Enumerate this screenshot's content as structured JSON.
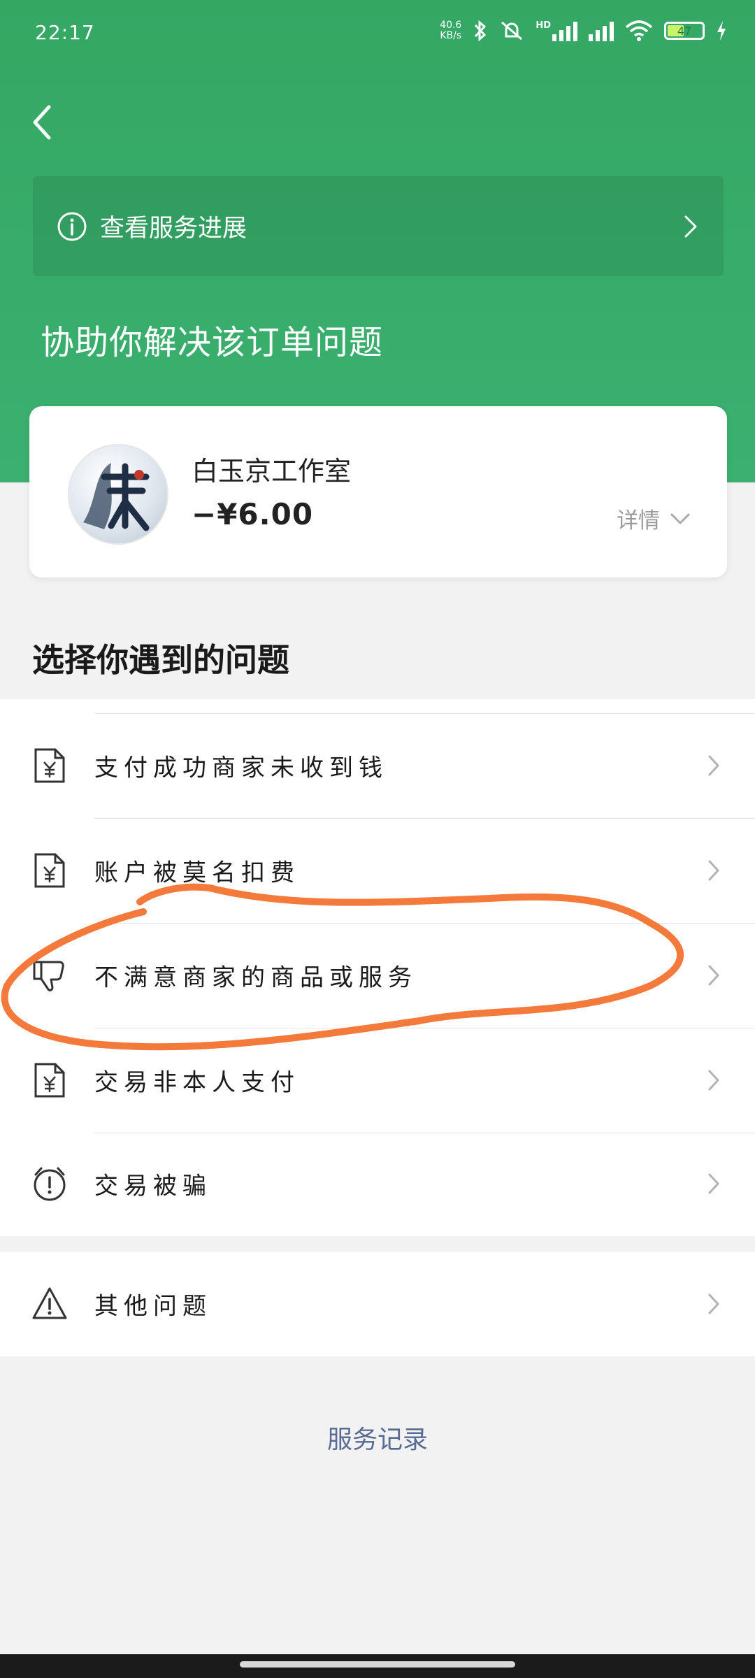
{
  "status_bar": {
    "time": "22:17",
    "net_speed_value": "40.6",
    "net_speed_unit": "KB/s",
    "network_type": "HD",
    "battery": "47"
  },
  "banner": {
    "label": "查看服务进展"
  },
  "page_title": "协助你解决该订单问题",
  "order": {
    "merchant_name": "白玉京工作室",
    "amount": "−¥6.00",
    "details_label": "详情"
  },
  "section_title": "选择你遇到的问题",
  "problems": [
    {
      "label": "支付成功商家未收到钱",
      "icon": "yuan-document-icon"
    },
    {
      "label": "账户被莫名扣费",
      "icon": "yuan-document-icon"
    },
    {
      "label": "不满意商家的商品或服务",
      "icon": "thumbs-down-icon"
    },
    {
      "label": "交易非本人支付",
      "icon": "yuan-document-icon"
    },
    {
      "label": "交易被骗",
      "icon": "alarm-icon"
    }
  ],
  "other_problem": {
    "label": "其他问题",
    "icon": "warning-icon"
  },
  "service_record": "服务记录",
  "colors": {
    "header_green": "#3bb070",
    "link_blue": "#576b95",
    "annotation_orange": "#f47a3c"
  }
}
